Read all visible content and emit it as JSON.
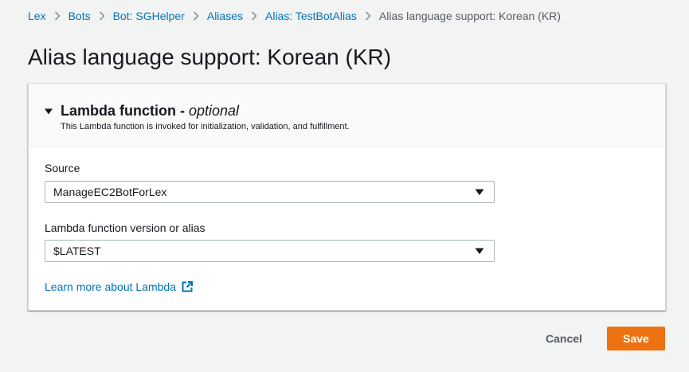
{
  "breadcrumb": {
    "items": [
      {
        "label": "Lex"
      },
      {
        "label": "Bots"
      },
      {
        "label": "Bot: SGHelper"
      },
      {
        "label": "Aliases"
      },
      {
        "label": "Alias: TestBotAlias"
      }
    ],
    "current": "Alias language support: Korean (KR)"
  },
  "page": {
    "title": "Alias language support: Korean (KR)"
  },
  "panel": {
    "title": "Lambda function",
    "dash": "-",
    "optional": "optional",
    "description": "This Lambda function is invoked for initialization, validation, and fulfillment.",
    "source": {
      "label": "Source",
      "value": "ManageEC2BotForLex"
    },
    "version": {
      "label": "Lambda function version or alias",
      "value": "$LATEST"
    },
    "learn_more": "Learn more about Lambda"
  },
  "footer": {
    "cancel_label": "Cancel",
    "save_label": "Save"
  },
  "colors": {
    "link": "#0073bb",
    "primary": "#ec7211",
    "background": "#f2f3f3"
  },
  "icons": {
    "breadcrumb_separator": "chevron-right-icon",
    "expand": "caret-down-icon",
    "select_arrow": "caret-down-icon",
    "external": "external-link-icon"
  }
}
